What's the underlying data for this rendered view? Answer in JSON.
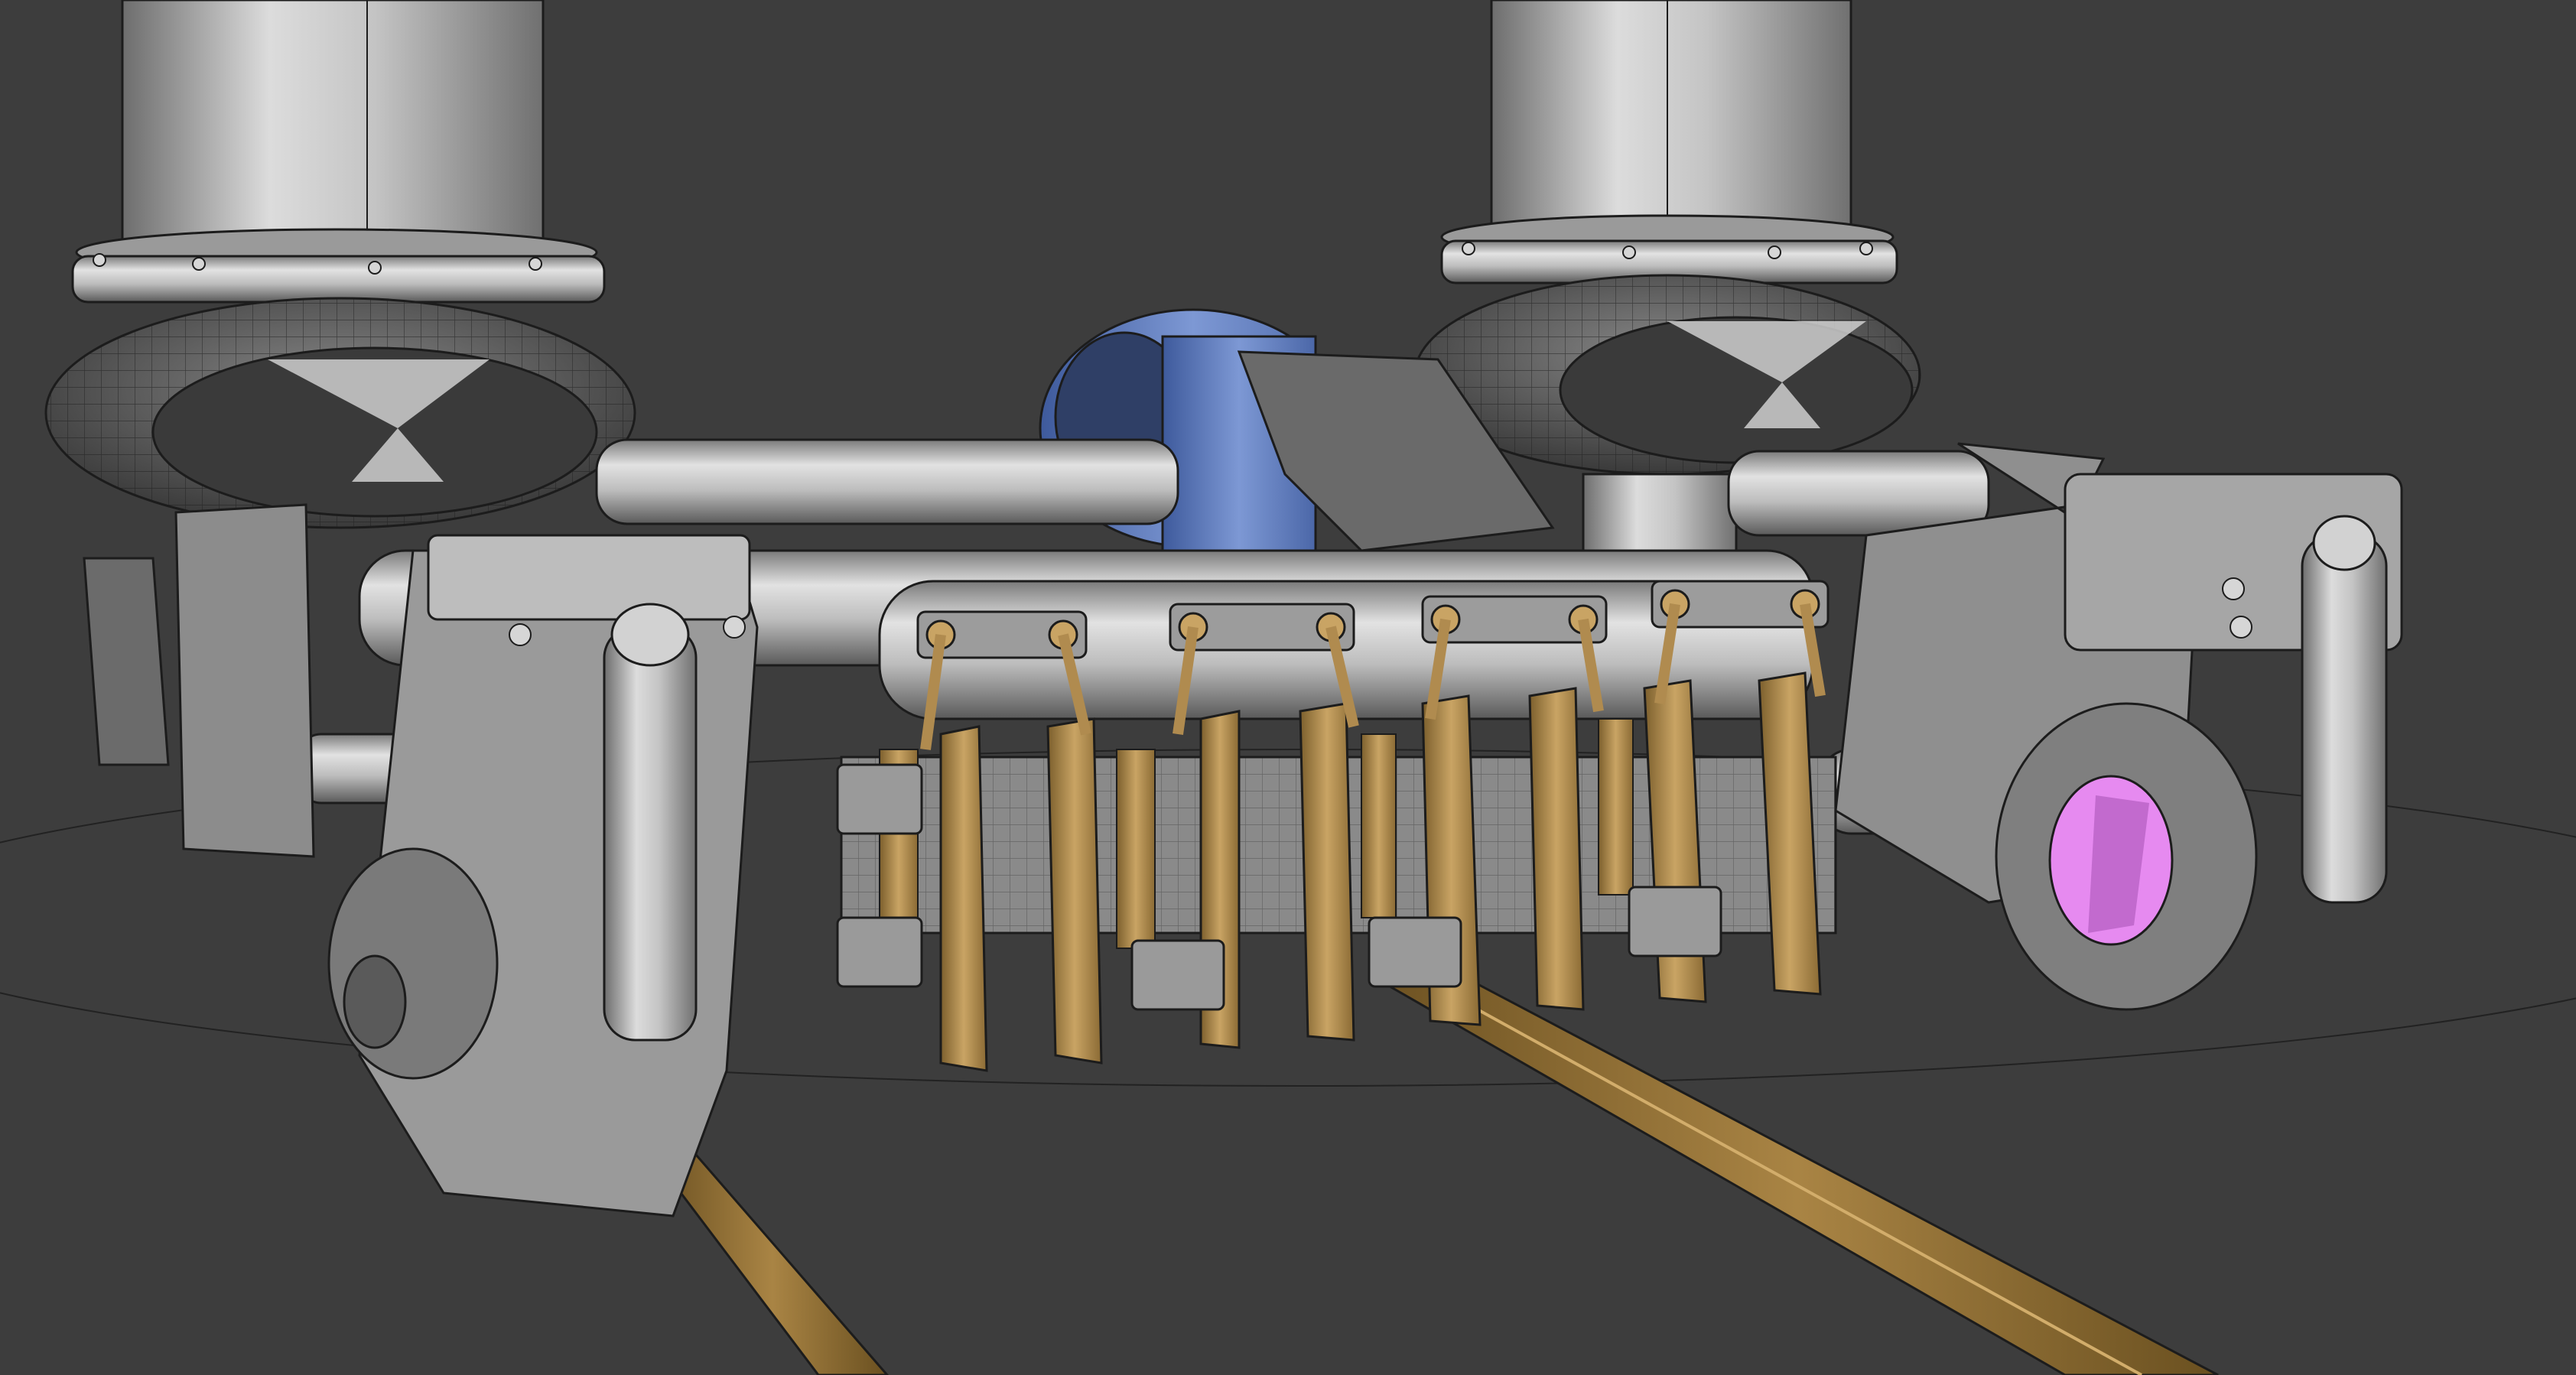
{
  "viewport": {
    "background": "#3d3d3d",
    "colors": {
      "steel": "#b9b9b9",
      "steel_dark": "#5c5c5c",
      "steel_shadow": "#2c2c2c",
      "bronze": "#b08b4f",
      "bronze_dark": "#6e5428",
      "blue_wheel": "#5a78b8",
      "magenta_port": "#e68af0",
      "wire": "#1f1f1f"
    },
    "icons": [
      "air-spring-icon",
      "brake-shoe-icon",
      "wheel-icon",
      "rail-icon"
    ]
  }
}
